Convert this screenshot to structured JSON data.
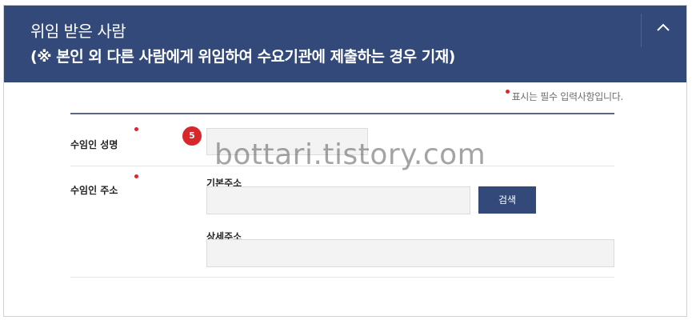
{
  "header": {
    "title": "위임 받은 사람",
    "subtitle": "(※ 본인 외 다른 사람에게 위임하여 수요기관에 제출하는 경우 기재)",
    "collapse_icon": "chevron-up-icon"
  },
  "form": {
    "required_note": "표시는 필수 입력사항입니다.",
    "recipient_name": {
      "label": "수임인 성명",
      "value": "",
      "step_badge": "5"
    },
    "recipient_address": {
      "label": "수임인 주소",
      "basic_address_label": "기본주소",
      "basic_address_value": "",
      "search_button_label": "검색",
      "detail_address_label": "상세주소",
      "detail_address_value": ""
    }
  },
  "watermark": "bottari.tistory.com",
  "colors": {
    "header_bg": "#33497a",
    "required_dot": "#d7282f",
    "badge": "#d7262c",
    "input_bg": "#f3f3f3"
  }
}
